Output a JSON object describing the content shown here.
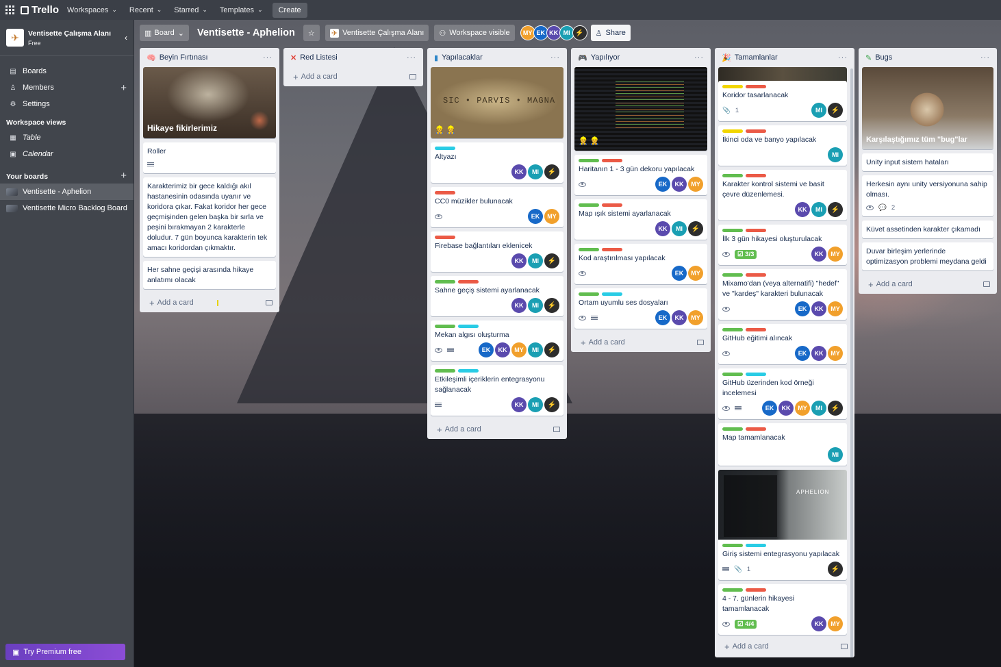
{
  "topbar": {
    "brand": "Trello",
    "nav": [
      "Workspaces",
      "Recent",
      "Starred",
      "Templates"
    ],
    "create": "Create"
  },
  "sidebar": {
    "workspace_name": "Ventisette Çalışma Alanı",
    "workspace_plan": "Free",
    "items": [
      {
        "label": "Boards",
        "icon": "trello-icon"
      },
      {
        "label": "Members",
        "icon": "user-icon"
      },
      {
        "label": "Settings",
        "icon": "gear-icon"
      }
    ],
    "views_heading": "Workspace views",
    "views": [
      {
        "label": "Table",
        "icon": "table-icon"
      },
      {
        "label": "Calendar",
        "icon": "calendar-icon"
      }
    ],
    "boards_heading": "Your boards",
    "boards": [
      "Ventisette - Aphelion",
      "Ventisette Micro Backlog Board"
    ],
    "premium": "Try Premium free"
  },
  "boardbar": {
    "view": "Board",
    "title": "Ventisette - Aphelion",
    "workspace": "Ventisette Çalışma Alanı",
    "visibility": "Workspace visible",
    "members": [
      "MY",
      "EK",
      "KK",
      "MI",
      "X"
    ],
    "share": "Share"
  },
  "add_card_label": "Add a card",
  "lists": {
    "beyin": {
      "title": "Beyin Fırtınası",
      "cover_caption": "Hikaye fikirlerimiz",
      "cards": [
        "Roller",
        "Karakterimiz bir gece kaldığı akıl hastanesinin odasında uyanır ve koridora çıkar. Fakat koridor her gece geçmişinden gelen başka bir sırla ve peşini bırakmayan 2 karakterle doludur. 7 gün boyunca karakterin tek amacı koridordan çıkmaktır.",
        "Her sahne geçişi arasında hikaye anlatımı olacak"
      ]
    },
    "red": {
      "title": "Red Listesi"
    },
    "yapilacaklar": {
      "title": "Yapılacaklar",
      "cover_text": "SIC • PARVIS • MAGNA",
      "cards": [
        "Altyazı",
        "CC0 müzikler bulunacak",
        "Firebase bağlantıları eklenicek",
        "Sahne geçiş sistemi ayarlanacak",
        "Mekan algısı oluşturma",
        "Etkileşimli içeriklerin entegrasyonu sağlanacak"
      ]
    },
    "yapiliyor": {
      "title": "Yapılıyor",
      "cards": [
        "Haritanın 1 - 3 gün dekoru yapılacak",
        "Map ışık sistemi ayarlanacak",
        "Kod araştırılması yapılacak",
        "Ortam uyumlu ses dosyaları"
      ]
    },
    "tamamlanlar": {
      "title": "Tamamlanlar",
      "cards": [
        "Koridor tasarlanacak",
        "İkinci oda ve banyo yapılacak",
        "Karakter kontrol sistemi ve basit çevre düzenlemesi.",
        "İlk 3 gün hikayesi oluşturulacak",
        "Mixamo'dan (veya alternatifi) \"hedef\" ve \"kardeş\" karakteri bulunacak",
        "GitHub eğitimi alıncak",
        "GitHub üzerinden kod örneği incelemesi",
        "Map tamamlanacak",
        "Giriş sistemi entegrasyonu yapılacak",
        "4 - 7. günlerin hikayesi tamamlanacak"
      ],
      "cover_title": "APHELION",
      "badge_attach": "1",
      "badge_check_3": "3/3",
      "badge_check_4": "4/4"
    },
    "bugs": {
      "title": "Bugs",
      "cover_caption": "Karşılaştığımız tüm \"bug\"lar",
      "cards": [
        "Unity input sistem hataları",
        "Herkesin aynı unity versiyonuna sahip olması.",
        "Küvet assetinden karakter çıkamadı",
        "Duvar birleşim yerlerinde optimizasyon problemi meydana geldi"
      ],
      "comments": "2"
    }
  }
}
